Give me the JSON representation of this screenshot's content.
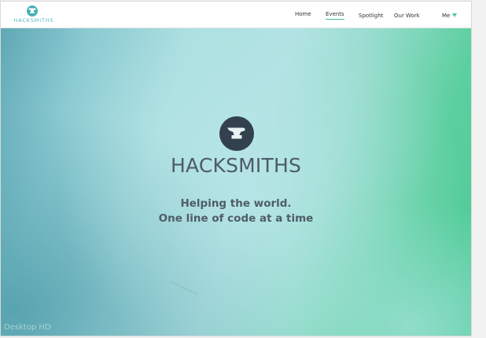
{
  "header": {
    "logo_text": "HACKSMITHS",
    "nav": {
      "home": "Home",
      "events": "Events",
      "spotlight": "Spotlight",
      "our_work": "Our Work",
      "me": "Me"
    }
  },
  "hero": {
    "brand": "HACKSMITHS",
    "tagline_line1": "Helping the world.",
    "tagline_line2": "One line of code at a time",
    "icon": "anvil-icon"
  },
  "watermark": "Desktop HD",
  "colors": {
    "accent": "#45b7a6",
    "logo": "#52b7bd",
    "icon_circle": "#33414f",
    "gradient_start": "#5fa8b5",
    "gradient_end": "#4cca96"
  }
}
